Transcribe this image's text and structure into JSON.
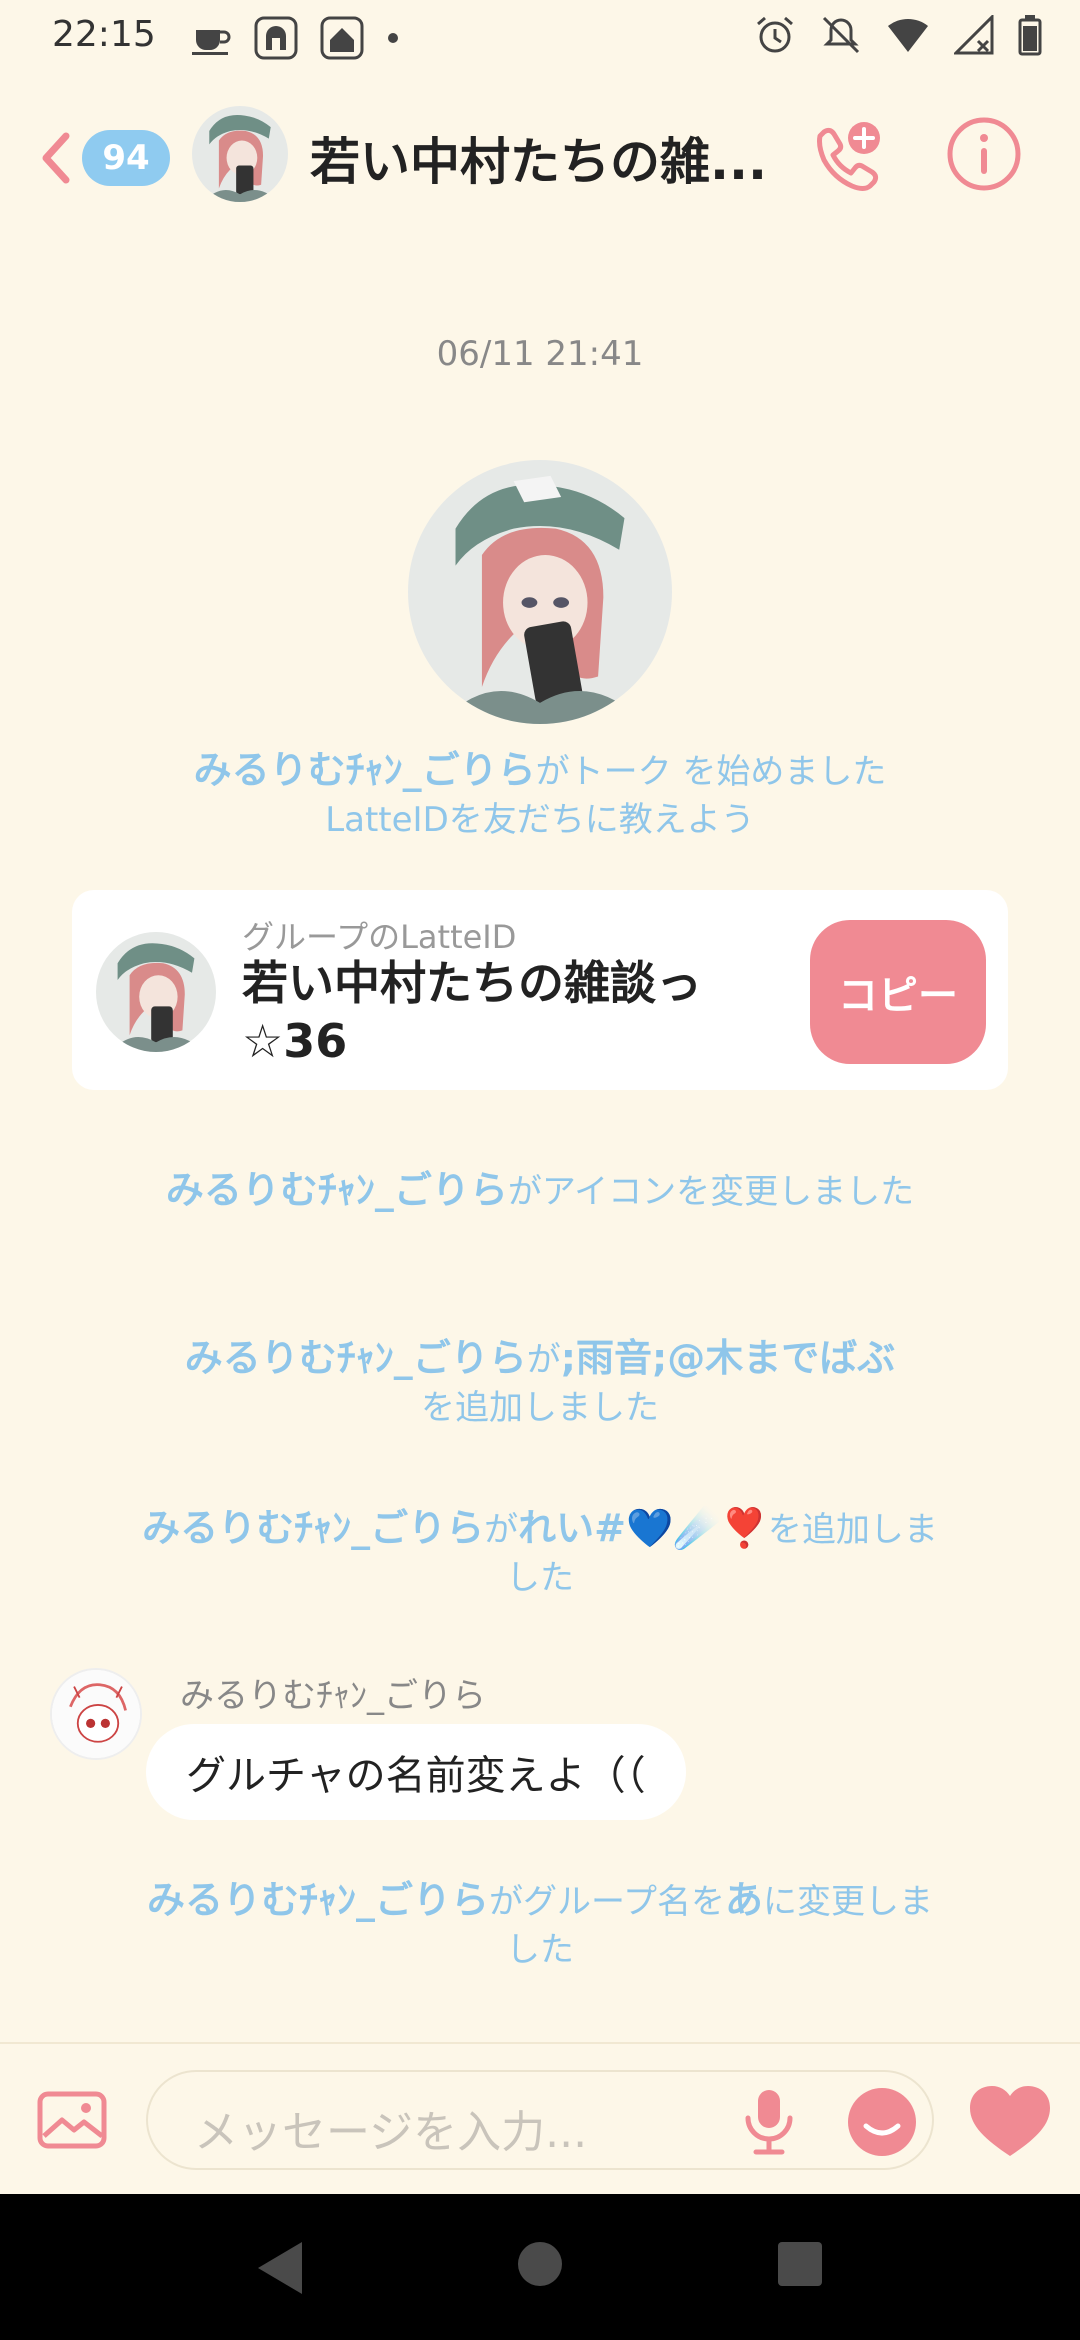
{
  "status_bar": {
    "time": "22:15",
    "icons_left": [
      "coffee-icon",
      "app-icon-1",
      "app-icon-2",
      "dot-icon"
    ],
    "icons_right": [
      "alarm-icon",
      "mute-icon",
      "wifi-icon",
      "signal-icon",
      "battery-icon"
    ]
  },
  "header": {
    "unread_count": "94",
    "title": "若い中村たちの雑...",
    "accent_color": "#f08a93"
  },
  "chat": {
    "timestamp": "06/11 21:41",
    "sys_started": {
      "user": "みるりむﾁｬﾝ_ごりら",
      "text": "がトーク を始めました",
      "sub": "LatteIDを友だちに教えよう"
    },
    "id_card": {
      "label": "グループのLatteID",
      "name": "若い中村たちの雑談っ☆36",
      "copy_label": "コピー"
    },
    "sys_icon_changed": {
      "user": "みるりむﾁｬﾝ_ごりら",
      "text": "がアイコンを変更しました"
    },
    "sys_added_1": {
      "user": "みるりむﾁｬﾝ_ごりら",
      "mid": "が",
      "target": ";雨音;@木までばぶ",
      "text": "を追加しました"
    },
    "sys_added_2": {
      "user": "みるりむﾁｬﾝ_ごりら",
      "mid": "が",
      "target": "れい#💙☄️❣️",
      "text": "を追加しました"
    },
    "message": {
      "sender": "みるりむﾁｬﾝ_ごりら",
      "text": "グルチャの名前変えよ（（"
    },
    "sys_renamed": {
      "user": "みるりむﾁｬﾝ_ごりら",
      "mid": "がグループ名を",
      "target": "あ",
      "text": "に変更しました"
    }
  },
  "input": {
    "placeholder": "メッセージを入力..."
  }
}
